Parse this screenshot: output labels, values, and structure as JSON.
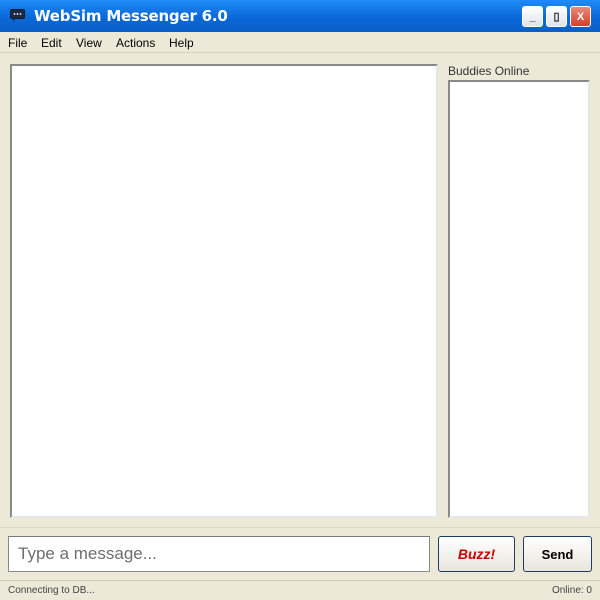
{
  "window": {
    "title": "WebSim Messenger 6.0",
    "minimize_label": "_",
    "maximize_label": "▯",
    "close_label": "X",
    "icon": "chat-bubble-icon"
  },
  "menu": {
    "items": [
      {
        "label": "File"
      },
      {
        "label": "Edit"
      },
      {
        "label": "View"
      },
      {
        "label": "Actions"
      },
      {
        "label": "Help"
      }
    ]
  },
  "buddies": {
    "label": "Buddies Online",
    "items": []
  },
  "chat": {
    "messages": []
  },
  "composer": {
    "placeholder": "Type a message...",
    "value": "",
    "buzz_label": "Buzz!",
    "send_label": "Send"
  },
  "status": {
    "left": "Connecting to DB...",
    "right": "Online: 0"
  },
  "colors": {
    "titlebar": "#0b68d8",
    "window_bg": "#ece9d8",
    "buzz_text": "#cc0000",
    "close_button": "#d2412c"
  }
}
